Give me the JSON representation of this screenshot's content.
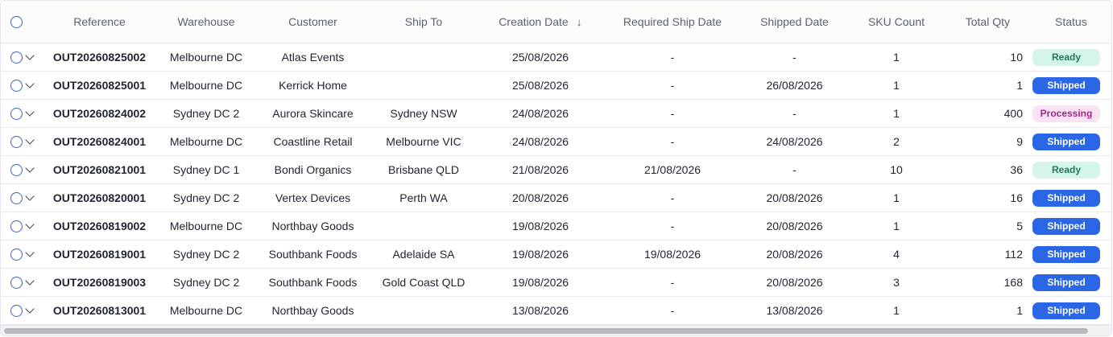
{
  "table": {
    "columns": {
      "reference": "Reference",
      "warehouse": "Warehouse",
      "customer": "Customer",
      "ship_to": "Ship To",
      "creation_date": "Creation Date",
      "required_ship_date": "Required Ship Date",
      "shipped_date": "Shipped Date",
      "sku_count": "SKU Count",
      "total_qty": "Total Qty",
      "status": "Status"
    },
    "sort_icon": "arrow-down-icon",
    "sort_glyph": "↓",
    "rows": [
      {
        "reference": "OUT20260825002",
        "warehouse": "Melbourne DC",
        "customer": "Atlas Events",
        "ship_to": "",
        "creation_date": "25/08/2026",
        "required_ship_date": "-",
        "shipped_date": "-",
        "sku_count": "1",
        "total_qty": "10",
        "status": "Ready"
      },
      {
        "reference": "OUT20260825001",
        "warehouse": "Melbourne DC",
        "customer": "Kerrick Home",
        "ship_to": "",
        "creation_date": "25/08/2026",
        "required_ship_date": "-",
        "shipped_date": "26/08/2026",
        "sku_count": "1",
        "total_qty": "1",
        "status": "Shipped"
      },
      {
        "reference": "OUT20260824002",
        "warehouse": "Sydney DC 2",
        "customer": "Aurora Skincare",
        "ship_to": "Sydney NSW",
        "creation_date": "24/08/2026",
        "required_ship_date": "-",
        "shipped_date": "-",
        "sku_count": "1",
        "total_qty": "400",
        "status": "Processing"
      },
      {
        "reference": "OUT20260824001",
        "warehouse": "Melbourne DC",
        "customer": "Coastline Retail",
        "ship_to": "Melbourne VIC",
        "creation_date": "24/08/2026",
        "required_ship_date": "-",
        "shipped_date": "24/08/2026",
        "sku_count": "2",
        "total_qty": "9",
        "status": "Shipped"
      },
      {
        "reference": "OUT20260821001",
        "warehouse": "Sydney DC 1",
        "customer": "Bondi Organics",
        "ship_to": "Brisbane QLD",
        "creation_date": "21/08/2026",
        "required_ship_date": "21/08/2026",
        "shipped_date": "-",
        "sku_count": "10",
        "total_qty": "36",
        "status": "Ready"
      },
      {
        "reference": "OUT20260820001",
        "warehouse": "Sydney DC 2",
        "customer": "Vertex Devices",
        "ship_to": "Perth WA",
        "creation_date": "20/08/2026",
        "required_ship_date": "-",
        "shipped_date": "20/08/2026",
        "sku_count": "1",
        "total_qty": "16",
        "status": "Shipped"
      },
      {
        "reference": "OUT20260819002",
        "warehouse": "Melbourne DC",
        "customer": "Northbay Goods",
        "ship_to": "",
        "creation_date": "19/08/2026",
        "required_ship_date": "-",
        "shipped_date": "20/08/2026",
        "sku_count": "1",
        "total_qty": "5",
        "status": "Shipped"
      },
      {
        "reference": "OUT20260819001",
        "warehouse": "Sydney DC 2",
        "customer": "Southbank Foods",
        "ship_to": "Adelaide SA",
        "creation_date": "19/08/2026",
        "required_ship_date": "19/08/2026",
        "shipped_date": "20/08/2026",
        "sku_count": "4",
        "total_qty": "112",
        "status": "Shipped"
      },
      {
        "reference": "OUT20260819003",
        "warehouse": "Sydney DC 2",
        "customer": "Southbank Foods",
        "ship_to": "Gold Coast QLD",
        "creation_date": "19/08/2026",
        "required_ship_date": "-",
        "shipped_date": "20/08/2026",
        "sku_count": "3",
        "total_qty": "168",
        "status": "Shipped"
      },
      {
        "reference": "OUT20260813001",
        "warehouse": "Melbourne DC",
        "customer": "Northbay Goods",
        "ship_to": "",
        "creation_date": "13/08/2026",
        "required_ship_date": "-",
        "shipped_date": "13/08/2026",
        "sku_count": "1",
        "total_qty": "1",
        "status": "Shipped"
      }
    ]
  },
  "colors": {
    "ready_bg": "#d5f5ec",
    "ready_text": "#1d7a57",
    "shipped_bg": "#2b66e6",
    "shipped_text": "#ffffff",
    "processing_bg": "#fbe3f4",
    "processing_text": "#a2258a",
    "checkbox_border": "#3b63c4"
  }
}
